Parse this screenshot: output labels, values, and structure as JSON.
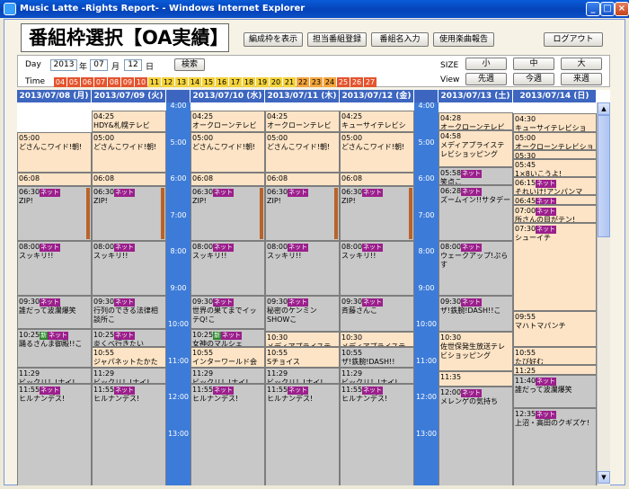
{
  "window": {
    "title": "Music Latte -Rights Report- - Windows Internet Explorer",
    "controls": [
      "_",
      "□",
      "×"
    ]
  },
  "page": {
    "title": "番組枠選択【OA実績】"
  },
  "toolbar": {
    "buttons": [
      "編成枠を表示",
      "担当番組登録",
      "番組名入力",
      "使用楽曲報告"
    ],
    "logout": "ログアウト"
  },
  "controls": {
    "day_label": "Day",
    "year": "2013",
    "year_unit": "年",
    "month": "07",
    "month_unit": "月",
    "day": "12",
    "day_unit": "日",
    "search": "検索",
    "time_label": "Time",
    "hours": [
      "04",
      "05",
      "06",
      "07",
      "08",
      "09",
      "10",
      "11",
      "12",
      "13",
      "14",
      "15",
      "16",
      "17",
      "18",
      "19",
      "20",
      "21",
      "22",
      "23",
      "24",
      "25",
      "26",
      "27"
    ],
    "size_label": "SIZE",
    "size_options": [
      "小",
      "中",
      "大"
    ],
    "view_label": "View",
    "view_options": [
      "先週",
      "今週",
      "来週"
    ]
  },
  "schedule": {
    "days": [
      "2013/07/08 (月)",
      "2013/07/09 (火)",
      "2013/07/10 (水)",
      "2013/07/11 (木)",
      "2013/07/12 (金)",
      "2013/07/13 (土)",
      "2013/07/14 (日)"
    ],
    "times": [
      "4:00",
      "5:00",
      "6:00",
      "7:00",
      "8:00",
      "9:00",
      "10:00",
      "11:00",
      "12:00",
      "13:00"
    ],
    "net": "ネット",
    "shin": "新",
    "programs": {
      "c1": [
        {
          "t": "05:00",
          "n": "どさんこワイド!朝!"
        },
        {
          "t": "06:08",
          "n": ""
        },
        {
          "t": "06:30",
          "n": "ZIP!",
          "net": true
        },
        {
          "t": "08:00",
          "n": "スッキリ!!",
          "net": true
        },
        {
          "t": "09:30",
          "n": "誰だって波瀾爆笑",
          "net": true
        },
        {
          "t": "10:25",
          "n": "踊るさんま御殿!!こ",
          "net": true,
          "shin": true
        },
        {
          "t": "11:29",
          "n": "ビックリ！!ナイ!..."
        },
        {
          "t": "11:55",
          "n": "ヒルナンデス!",
          "net": true
        }
      ],
      "c2": [
        {
          "t": "04:25",
          "n": "HDY&札幌テレビ"
        },
        {
          "t": "05:00",
          "n": "どさんこワイド!朝!"
        },
        {
          "t": "06:08",
          "n": ""
        },
        {
          "t": "06:30",
          "n": "ZIP!",
          "net": true
        },
        {
          "t": "08:00",
          "n": "スッキリ!!",
          "net": true
        },
        {
          "t": "09:30",
          "n": "行列のできる法律相談所こ",
          "net": true
        },
        {
          "t": "10:25",
          "n": "炎くべ行きたい",
          "net": true
        },
        {
          "t": "10:55",
          "n": "ジャパネットたかた生"
        },
        {
          "t": "11:29",
          "n": "ビックリ！!ナイ!..."
        },
        {
          "t": "11:55",
          "n": "ヒルナンデス!",
          "net": true
        }
      ],
      "c3": [
        {
          "t": "04:25",
          "n": "オークローンテレビショ"
        },
        {
          "t": "05:00",
          "n": "どさんこワイド!朝!"
        },
        {
          "t": "06:08",
          "n": ""
        },
        {
          "t": "06:30",
          "n": "ZIP!",
          "net": true
        },
        {
          "t": "08:00",
          "n": "スッキリ!!",
          "net": true
        },
        {
          "t": "09:30",
          "n": "世界の果てまでイッテQ!こ",
          "net": true
        },
        {
          "t": "10:25",
          "n": "女神のマルシェ",
          "net": true,
          "shin": true
        },
        {
          "t": "10:55",
          "n": "インターワールド会社"
        },
        {
          "t": "11:29",
          "n": "ビックリ！!ナイ!..."
        },
        {
          "t": "11:55",
          "n": "ヒルナンデス!",
          "net": true
        }
      ],
      "c4": [
        {
          "t": "04:25",
          "n": "オークローンテレビショ"
        },
        {
          "t": "05:00",
          "n": "どさんこワイド!朝!"
        },
        {
          "t": "06:08",
          "n": ""
        },
        {
          "t": "06:30",
          "n": "ZIP!",
          "net": true
        },
        {
          "t": "08:00",
          "n": "スッキリ!!",
          "net": true
        },
        {
          "t": "09:30",
          "n": "秘密のケンミンSHOWこ",
          "net": true
        },
        {
          "t": "10:30",
          "n": "メディアプライステレビショッピング"
        },
        {
          "t": "10:55",
          "n": "Sチョイス"
        },
        {
          "t": "11:29",
          "n": "ビックリ！!ナイ!..."
        },
        {
          "t": "11:55",
          "n": "ヒルナンデス!",
          "net": true
        }
      ],
      "c5": [
        {
          "t": "04:25",
          "n": "キューサイテレビショ"
        },
        {
          "t": "05:00",
          "n": "どさんこワイド!朝!"
        },
        {
          "t": "06:08",
          "n": ""
        },
        {
          "t": "06:30",
          "n": "ZIP!",
          "net": true
        },
        {
          "t": "08:00",
          "n": "スッキリ!!",
          "net": true
        },
        {
          "t": "09:30",
          "n": "斉藤さんこ",
          "net": true
        },
        {
          "t": "10:30",
          "n": "メディアプライステレビショッピング"
        },
        {
          "t": "10:55",
          "n": "ザ!鉄腕!DASH!!"
        },
        {
          "t": "11:29",
          "n": "ビックリ！!ナイ!..."
        },
        {
          "t": "11:55",
          "n": "ヒルナンデス!",
          "net": true
        }
      ],
      "c6": [
        {
          "t": "04:28",
          "n": "オークローンテレビショ"
        },
        {
          "t": "04:58",
          "n": "メディアプライステレビショッピング"
        },
        {
          "t": "05:58",
          "n": "笑点こ",
          "net": true
        },
        {
          "t": "06:28",
          "n": "ズームイン!!サタデー",
          "net": true
        },
        {
          "t": "08:00",
          "n": "ウェークアップ!ぷらす",
          "net": true
        },
        {
          "t": "09:30",
          "n": "ザ!鉄腕!DASH!!こ",
          "net": true
        },
        {
          "t": "10:30",
          "n": "佐世保発生放送テレビショッピング"
        },
        {
          "t": "11:35",
          "n": ""
        },
        {
          "t": "12:00",
          "n": "メレンゲの気持ち",
          "net": true
        }
      ],
      "c7": [
        {
          "t": "04:30",
          "n": "キューサイテレビショ"
        },
        {
          "t": "05:00",
          "n": "オークローンテレビショ"
        },
        {
          "t": "05:30",
          "n": ""
        },
        {
          "t": "05:45",
          "n": "1×8いこうよ!"
        },
        {
          "t": "06:15",
          "n": "それいけ!アンパンマ",
          "net": true
        },
        {
          "t": "06:45",
          "n": "",
          "net": true
        },
        {
          "t": "07:00",
          "n": "所さんの目がテン!",
          "net": true
        },
        {
          "t": "07:30",
          "n": "シューイチ",
          "net": true
        },
        {
          "t": "09:55",
          "n": "マハトマパンチ"
        },
        {
          "t": "10:55",
          "n": "たび好む"
        },
        {
          "t": "11:25",
          "n": ""
        },
        {
          "t": "11:40",
          "n": "誰だって波瀾爆笑",
          "net": true
        },
        {
          "t": "12:35",
          "n": "上沼・高田のクギズケ!",
          "net": true
        }
      ]
    }
  }
}
